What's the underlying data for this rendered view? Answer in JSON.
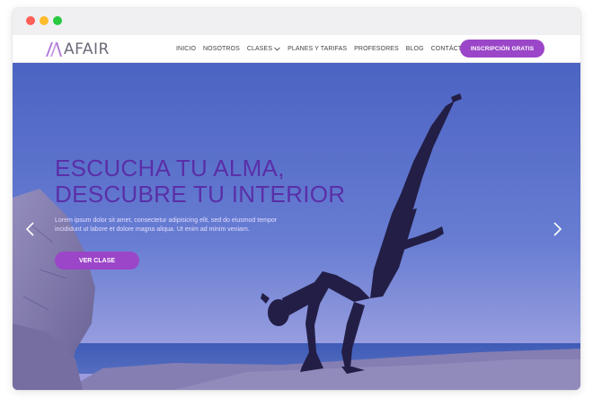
{
  "brand": {
    "name": "AFAIR",
    "accent": "#9b46c8",
    "title_color": "#5a2fa8"
  },
  "nav": {
    "items": [
      {
        "label": "INICIO"
      },
      {
        "label": "NOSOTROS"
      },
      {
        "label": "CLASES",
        "icon": "chevron-down-icon"
      },
      {
        "label": "PLANES Y TARIFAS"
      },
      {
        "label": "PROFESORES"
      },
      {
        "label": "BLOG"
      },
      {
        "label": "CONTÁCTANOS"
      }
    ],
    "cta_label": "INSCRIPCIÓN GRATIS"
  },
  "hero": {
    "title_line1": "ESCUCHA TU ALMA,",
    "title_line2": "DESCUBRE TU INTERIOR",
    "text_line1": "Lorem ipsum dolor sit amet, consectetur adipisicing elit, sed do eiusmod tempor",
    "text_line2": "incididunt ut labore et dolore magna aliqua. Ut enim ad minim veniam.",
    "button_label": "VER CLASE",
    "prev_icon": "chevron-left-icon",
    "next_icon": "chevron-right-icon"
  }
}
